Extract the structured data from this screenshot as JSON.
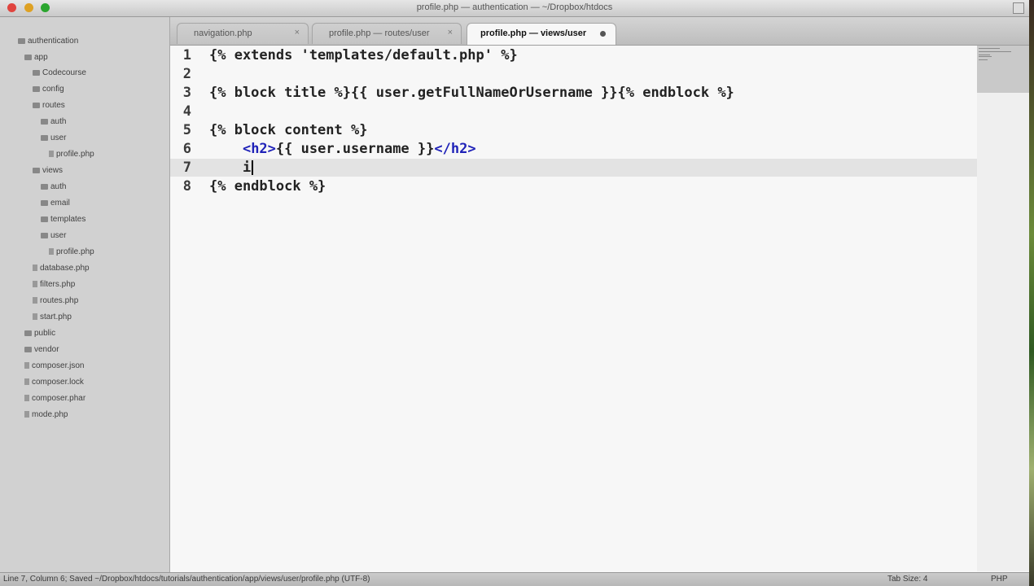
{
  "window": {
    "title": "profile.php — authentication — ~/Dropbox/htdocs"
  },
  "sidebar": {
    "items": [
      {
        "label": "authentication",
        "type": "folder"
      },
      {
        "label": "app",
        "type": "folder"
      },
      {
        "label": "Codecourse",
        "type": "folder"
      },
      {
        "label": "config",
        "type": "folder"
      },
      {
        "label": "routes",
        "type": "folder"
      },
      {
        "label": "auth",
        "type": "folder"
      },
      {
        "label": "user",
        "type": "folder"
      },
      {
        "label": "profile.php",
        "type": "file"
      },
      {
        "label": "views",
        "type": "folder"
      },
      {
        "label": "auth",
        "type": "folder"
      },
      {
        "label": "email",
        "type": "folder"
      },
      {
        "label": "templates",
        "type": "folder"
      },
      {
        "label": "user",
        "type": "folder"
      },
      {
        "label": "profile.php",
        "type": "file"
      },
      {
        "label": "database.php",
        "type": "file"
      },
      {
        "label": "filters.php",
        "type": "file"
      },
      {
        "label": "routes.php",
        "type": "file"
      },
      {
        "label": "start.php",
        "type": "file"
      },
      {
        "label": "public",
        "type": "folder"
      },
      {
        "label": "vendor",
        "type": "folder"
      },
      {
        "label": "composer.json",
        "type": "file"
      },
      {
        "label": "composer.lock",
        "type": "file"
      },
      {
        "label": "composer.phar",
        "type": "file"
      },
      {
        "label": "mode.php",
        "type": "file"
      }
    ]
  },
  "tabs": [
    {
      "label": "navigation.php",
      "close": "×"
    },
    {
      "label": "profile.php — routes/user",
      "close": "×"
    },
    {
      "label": "profile.php — views/user",
      "close": "●"
    }
  ],
  "editor": {
    "line_numbers": [
      "1",
      "2",
      "3",
      "4",
      "5",
      "6",
      "7",
      "8"
    ],
    "lines": [
      "{% extends 'templates/default.php' %}",
      "",
      "{% block title %}{{ user.getFullNameOrUsername }}{% endblock %}",
      "",
      "{% block content %}",
      "",
      "    i",
      "{% endblock %}"
    ],
    "line6": {
      "indent": "    ",
      "open_tag": "<h2>",
      "content": "{{ user.username }}",
      "close_tag": "</h2>"
    },
    "current_line": 7
  },
  "statusbar": {
    "left": "Line 7, Column 6; Saved ~/Dropbox/htdocs/tutorials/authentication/app/views/user/profile.php (UTF-8)",
    "tab_size": "Tab Size: 4",
    "syntax": "PHP"
  },
  "colors": {
    "editor_bg": "#f7f7f7",
    "sidebar_bg": "#d1d1d1",
    "tag_blue": "#1f22b8",
    "current_line": "#e3e3e3"
  }
}
